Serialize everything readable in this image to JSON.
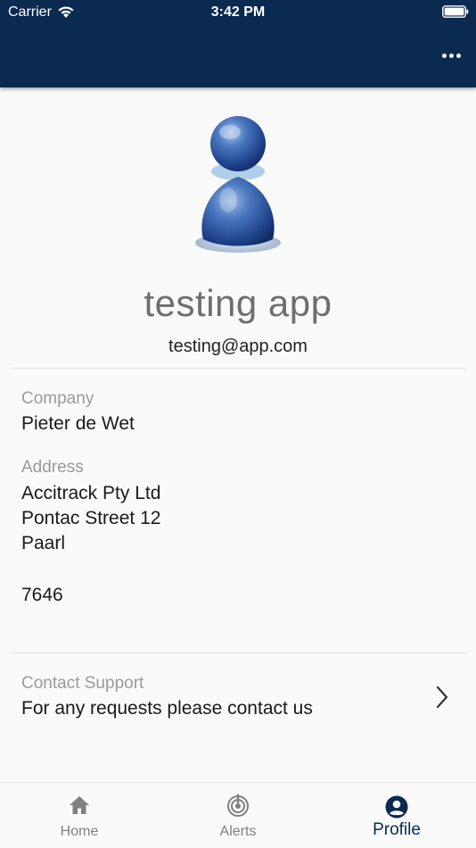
{
  "status_bar": {
    "carrier": "Carrier",
    "time": "3:42 PM"
  },
  "header": {
    "menu_icon": "more-horizontal-icon",
    "background_color": "#0a2a4f"
  },
  "profile": {
    "avatar_icon": "user-avatar-icon",
    "name": "testing app",
    "email": "testing@app.com"
  },
  "company": {
    "label": "Company",
    "value": "Pieter de Wet"
  },
  "address": {
    "label": "Address",
    "lines": [
      "Accitrack Pty Ltd",
      "Pontac Street 12",
      "Paarl",
      "",
      "7646"
    ]
  },
  "support": {
    "label": "Contact Support",
    "value": "For any requests please contact us",
    "icon": "chevron-right-icon"
  },
  "tabs": [
    {
      "label": "Home",
      "icon": "home-icon",
      "active": false
    },
    {
      "label": "Alerts",
      "icon": "alerts-icon",
      "active": false
    },
    {
      "label": "Profile",
      "icon": "profile-icon",
      "active": true
    }
  ],
  "colors": {
    "brand": "#0a2a4f",
    "label_gray": "#9a9a9a",
    "inactive_tab": "#808080"
  }
}
